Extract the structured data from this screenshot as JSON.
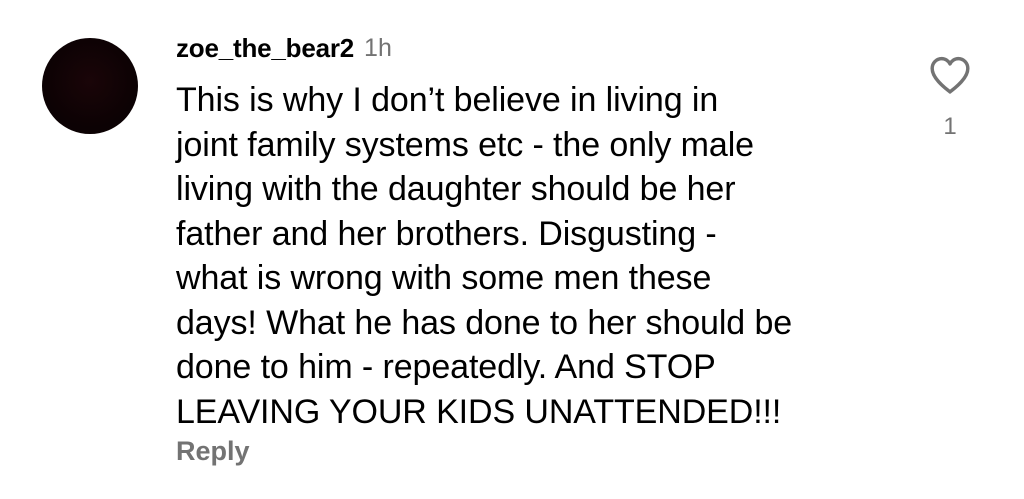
{
  "comment": {
    "username": "zoe_the_bear2",
    "timestamp": "1h",
    "text": "This is why I don’t believe in living in\njoint family systems etc - the only male\nliving with the daughter should be her\nfather and her brothers. Disgusting -\nwhat is wrong with some men these\ndays! What he has done to her should be\ndone to him - repeatedly. And STOP\nLEAVING YOUR KIDS UNATTENDED!!!",
    "reply_label": "Reply",
    "like_count": "1",
    "like_icon": "heart-outline-icon"
  },
  "colors": {
    "primary_text": "#000000",
    "secondary_text": "#737373",
    "avatar": "#0d0204",
    "background": "#ffffff"
  }
}
